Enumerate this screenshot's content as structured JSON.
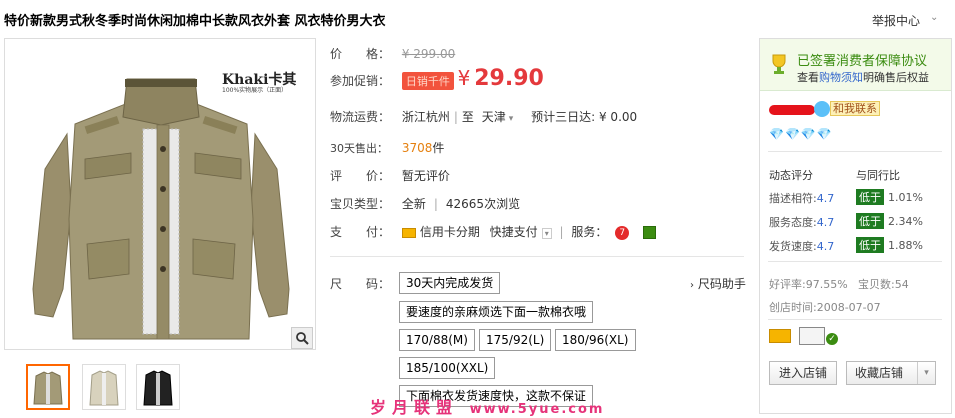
{
  "title": "特价新款男式秋冬季时尚休闲加棉中长款风衣外套 风衣特价男大衣",
  "report": {
    "label": "举报中心"
  },
  "image": {
    "brand_text": "Khaki卡其",
    "brand_sub": "100%实物展示（正面）"
  },
  "info": {
    "price_label": "价　　格：",
    "original_price": "¥ 299.00",
    "promo_label": "参加促销：",
    "promo_tag": "日销千件",
    "promo_currency": "¥",
    "promo_price": "29.90",
    "shipping_label": "物流运费：",
    "ship_from": "浙江杭州",
    "ship_to_prefix": "至",
    "ship_to": "天津",
    "arrival_label": "预计三日达:",
    "shipping_fee": "¥ 0.00",
    "sold_label": "30天售出：",
    "sold_count": "3708",
    "sold_unit": "件",
    "review_label": "评　　价：",
    "review_value": "暂无评价",
    "type_label": "宝贝类型：",
    "type_value": "全新",
    "views": "42665次浏览",
    "pay_label": "支　　付：",
    "pay_installment": "信用卡分期",
    "pay_quick": "快捷支付",
    "service_label": "服务："
  },
  "size": {
    "label": "尺　　码：",
    "helper": "尺码助手",
    "options": [
      "30天内完成发货",
      "要速度的亲麻烦选下面一款棉衣哦",
      "170/88(M)",
      "175/92(L)",
      "180/96(XL)",
      "185/100(XXL)",
      "下面棉衣发货速度快，这款不保证"
    ]
  },
  "panel": {
    "guarantee_title": "已签署消费者保障协议",
    "guarantee_sub_prefix": "查看",
    "guarantee_link": "购物须知",
    "guarantee_sub_suffix": "明确售后权益",
    "contact": "和我联系",
    "diamonds": "💎💎💎💎",
    "rating_label": "动态评分",
    "compare_label": "与同行比",
    "ratings": [
      {
        "label": "描述相符:",
        "score": "4.7",
        "compare": "低于",
        "pct": "1.01%"
      },
      {
        "label": "服务态度:",
        "score": "4.7",
        "compare": "低于",
        "pct": "2.34%"
      },
      {
        "label": "发货速度:",
        "score": "4.7",
        "compare": "低于",
        "pct": "1.88%"
      }
    ],
    "good_rate": "好评率:97.55%",
    "item_count": "宝贝数:54",
    "open_date": "创店时间:2008-07-07",
    "enter_shop": "进入店铺",
    "fav_shop": "收藏店铺"
  },
  "watermark": {
    "text": "岁月联盟",
    "url": "www.5yue.com"
  },
  "colors": {
    "price": "#e4393c",
    "guarantee_green": "#3b8c11",
    "low_badge": "#1e7b21",
    "sold_orange": "#e5800f"
  }
}
